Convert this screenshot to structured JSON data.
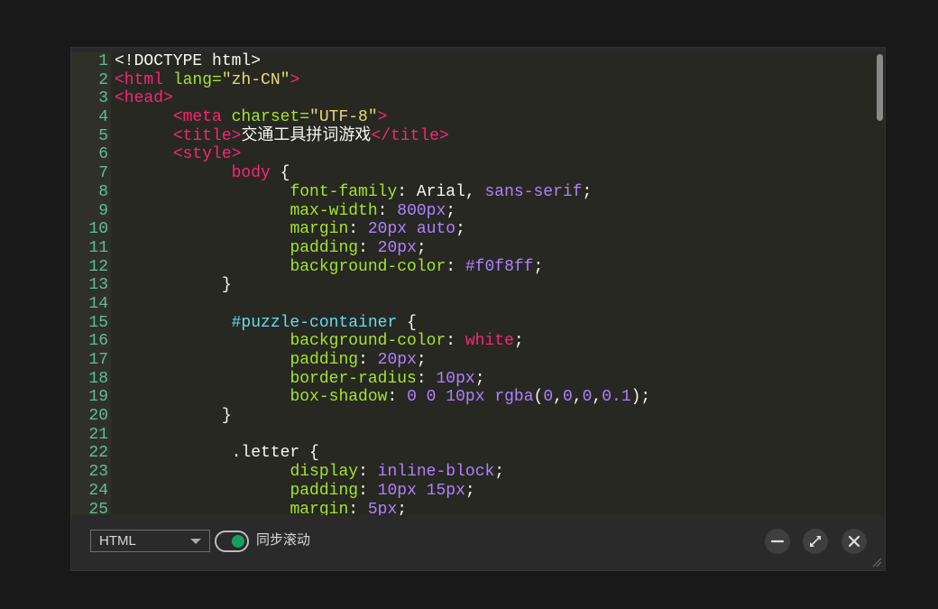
{
  "editor": {
    "lines": [
      {
        "n": "1",
        "tokens": [
          [
            "plain",
            "<!DOCTYPE html>"
          ]
        ]
      },
      {
        "n": "2",
        "tokens": [
          [
            "tag",
            "<html"
          ],
          [
            "attr",
            " lang="
          ],
          [
            "str",
            "\"zh-CN\""
          ],
          [
            "tag",
            ">"
          ]
        ]
      },
      {
        "n": "3",
        "tokens": [
          [
            "tag",
            "<head>"
          ]
        ]
      },
      {
        "n": "4",
        "tokens": [
          [
            "plain",
            "      "
          ],
          [
            "tag",
            "<meta"
          ],
          [
            "attr",
            " charset="
          ],
          [
            "str",
            "\"UTF-8\""
          ],
          [
            "tag",
            ">"
          ]
        ]
      },
      {
        "n": "5",
        "tokens": [
          [
            "plain",
            "      "
          ],
          [
            "tag",
            "<title>"
          ],
          [
            "plain",
            "交通工具拼词游戏"
          ],
          [
            "tag",
            "</title>"
          ]
        ]
      },
      {
        "n": "6",
        "tokens": [
          [
            "plain",
            "      "
          ],
          [
            "tag",
            "<style>"
          ]
        ]
      },
      {
        "n": "7",
        "tokens": [
          [
            "plain",
            "            "
          ],
          [
            "sel",
            "body"
          ],
          [
            "plain",
            " {"
          ]
        ]
      },
      {
        "n": "8",
        "tokens": [
          [
            "plain",
            "                  "
          ],
          [
            "prop",
            "font-family"
          ],
          [
            "plain",
            ": Arial, "
          ],
          [
            "kw",
            "sans-serif"
          ],
          [
            "plain",
            ";"
          ]
        ]
      },
      {
        "n": "9",
        "tokens": [
          [
            "plain",
            "                  "
          ],
          [
            "prop",
            "max-width"
          ],
          [
            "plain",
            ": "
          ],
          [
            "num",
            "800px"
          ],
          [
            "plain",
            ";"
          ]
        ]
      },
      {
        "n": "10",
        "tokens": [
          [
            "plain",
            "                  "
          ],
          [
            "prop",
            "margin"
          ],
          [
            "plain",
            ": "
          ],
          [
            "num",
            "20px"
          ],
          [
            "plain",
            " "
          ],
          [
            "kw",
            "auto"
          ],
          [
            "plain",
            ";"
          ]
        ]
      },
      {
        "n": "11",
        "tokens": [
          [
            "plain",
            "                  "
          ],
          [
            "prop",
            "padding"
          ],
          [
            "plain",
            ": "
          ],
          [
            "num",
            "20px"
          ],
          [
            "plain",
            ";"
          ]
        ]
      },
      {
        "n": "12",
        "tokens": [
          [
            "plain",
            "                  "
          ],
          [
            "prop",
            "background-color"
          ],
          [
            "plain",
            ": "
          ],
          [
            "num",
            "#f0f8ff"
          ],
          [
            "plain",
            ";"
          ]
        ]
      },
      {
        "n": "13",
        "tokens": [
          [
            "plain",
            "           }"
          ]
        ]
      },
      {
        "n": "14",
        "tokens": [
          [
            "plain",
            ""
          ]
        ]
      },
      {
        "n": "15",
        "tokens": [
          [
            "plain",
            "            "
          ],
          [
            "id",
            "#puzzle-container"
          ],
          [
            "plain",
            " {"
          ]
        ]
      },
      {
        "n": "16",
        "tokens": [
          [
            "plain",
            "                  "
          ],
          [
            "prop",
            "background-color"
          ],
          [
            "plain",
            ": "
          ],
          [
            "red",
            "white"
          ],
          [
            "plain",
            ";"
          ]
        ]
      },
      {
        "n": "17",
        "tokens": [
          [
            "plain",
            "                  "
          ],
          [
            "prop",
            "padding"
          ],
          [
            "plain",
            ": "
          ],
          [
            "num",
            "20px"
          ],
          [
            "plain",
            ";"
          ]
        ]
      },
      {
        "n": "18",
        "tokens": [
          [
            "plain",
            "                  "
          ],
          [
            "prop",
            "border-radius"
          ],
          [
            "plain",
            ": "
          ],
          [
            "num",
            "10px"
          ],
          [
            "plain",
            ";"
          ]
        ]
      },
      {
        "n": "19",
        "tokens": [
          [
            "plain",
            "                  "
          ],
          [
            "prop",
            "box-shadow"
          ],
          [
            "plain",
            ": "
          ],
          [
            "num",
            "0 0 10px"
          ],
          [
            "plain",
            " "
          ],
          [
            "kw",
            "rgba"
          ],
          [
            "plain",
            "("
          ],
          [
            "num",
            "0"
          ],
          [
            "plain",
            ","
          ],
          [
            "num",
            "0"
          ],
          [
            "plain",
            ","
          ],
          [
            "num",
            "0"
          ],
          [
            "plain",
            ","
          ],
          [
            "num",
            "0.1"
          ],
          [
            "plain",
            ");"
          ]
        ]
      },
      {
        "n": "20",
        "tokens": [
          [
            "plain",
            "           }"
          ]
        ]
      },
      {
        "n": "21",
        "tokens": [
          [
            "plain",
            ""
          ]
        ]
      },
      {
        "n": "22",
        "tokens": [
          [
            "plain",
            "            .letter {"
          ]
        ]
      },
      {
        "n": "23",
        "tokens": [
          [
            "plain",
            "                  "
          ],
          [
            "prop",
            "display"
          ],
          [
            "plain",
            ": "
          ],
          [
            "kw",
            "inline-block"
          ],
          [
            "plain",
            ";"
          ]
        ]
      },
      {
        "n": "24",
        "tokens": [
          [
            "plain",
            "                  "
          ],
          [
            "prop",
            "padding"
          ],
          [
            "plain",
            ": "
          ],
          [
            "num",
            "10px 15px"
          ],
          [
            "plain",
            ";"
          ]
        ]
      },
      {
        "n": "25",
        "tokens": [
          [
            "plain",
            "                  "
          ],
          [
            "prop",
            "margin"
          ],
          [
            "plain",
            ": "
          ],
          [
            "num",
            "5px"
          ],
          [
            "plain",
            ";"
          ]
        ]
      }
    ]
  },
  "footer": {
    "language": "HTML",
    "sync_scroll_label": "同步滚动",
    "sync_scroll_on": true
  },
  "icons": {
    "minimize": "minimize-icon",
    "expand": "expand-icon",
    "close": "close-icon",
    "dropdown": "chevron-down-icon",
    "resize": "resize-grip-icon"
  },
  "colors": {
    "toggle_on": "#15a063",
    "tag": "#f92672",
    "attr": "#a6e22e",
    "string": "#e6db74",
    "number": "#ae81ff",
    "line_number": "#5fbf8f"
  }
}
